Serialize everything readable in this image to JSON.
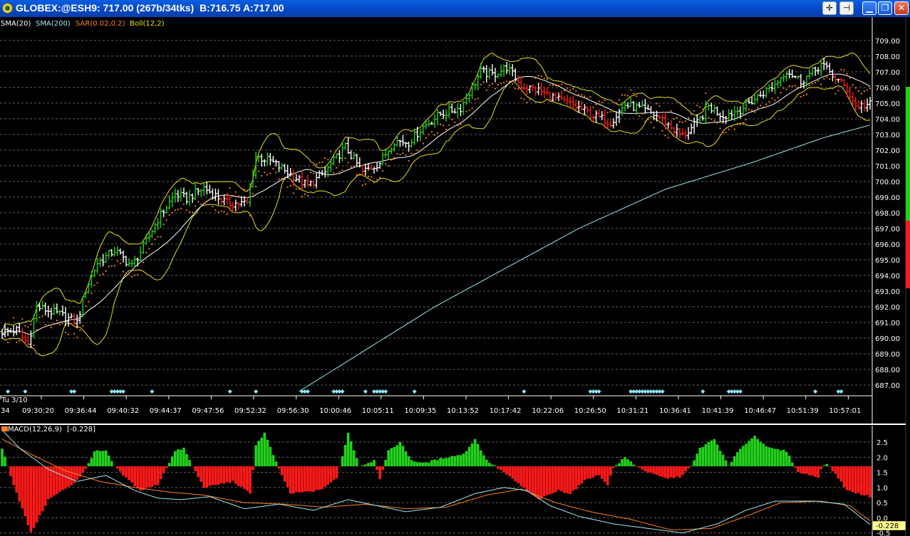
{
  "window": {
    "title": "GLOBEX:@ESH9: 717.00 (267b/34tks)  B:716.75 A:717.00",
    "buttons": [
      "crosshair-button",
      "pin-button",
      "minimize-button",
      "restore-button",
      "close-button"
    ]
  },
  "colors": {
    "up": "#22d11c",
    "down": "#ff1a1a",
    "neutral": "#ffffff",
    "sma20": "#ffffff",
    "sma200": "#9de8f0",
    "sar": "#ff8020",
    "boll": "#e8e020",
    "grid": "#606060",
    "markers": "#8fe8ff"
  },
  "chart_data": [
    {
      "type": "line",
      "title": "",
      "indicators": [
        {
          "name": "SMA(20)",
          "color": "#ffffff"
        },
        {
          "name": "SMA(200)",
          "color": "#9de8f0"
        },
        {
          "name": "SAR(0.02,0.2)",
          "color": "#ff8020"
        },
        {
          "name": "Boll(12,2)",
          "color": "#e8e020"
        }
      ],
      "ylim": [
        686.5,
        709.4
      ],
      "y_ticks": [
        "709.00",
        "708.00",
        "707.00",
        "706.00",
        "705.00",
        "704.00",
        "703.00",
        "702.00",
        "701.00",
        "700.00",
        "699.00",
        "698.00",
        "697.00",
        "696.00",
        "695.00",
        "694.00",
        "693.00",
        "692.00",
        "691.00",
        "690.00",
        "689.00",
        "688.00",
        "687.00"
      ],
      "date_label": "Tu 3/10",
      "x_ticks": [
        "34",
        "09:30:20",
        "09:36:44",
        "09:40:32",
        "09:44:37",
        "09:47:56",
        "09:52:32",
        "09:56:30",
        "10:00:46",
        "10:05:11",
        "10:09:35",
        "10:13:52",
        "10:17:42",
        "10:22:06",
        "10:26:50",
        "10:31:21",
        "10:36:41",
        "10:41:39",
        "10:46:47",
        "10:51:39",
        "10:57:01"
      ],
      "price_anchors": [
        [
          0,
          690.4
        ],
        [
          5,
          690.5
        ],
        [
          9,
          689.6
        ],
        [
          12,
          692.0
        ],
        [
          20,
          691.5
        ],
        [
          26,
          691.0
        ],
        [
          29,
          693.1
        ],
        [
          33,
          694.8
        ],
        [
          39,
          695.6
        ],
        [
          45,
          694.6
        ],
        [
          49,
          695.8
        ],
        [
          54,
          697.6
        ],
        [
          60,
          699.2
        ],
        [
          64,
          698.9
        ],
        [
          70,
          699.6
        ],
        [
          78,
          698.6
        ],
        [
          85,
          698.6
        ],
        [
          88,
          701.6
        ],
        [
          93,
          701.3
        ],
        [
          98,
          700.7
        ],
        [
          106,
          699.7
        ],
        [
          112,
          700.6
        ],
        [
          119,
          702.2
        ],
        [
          125,
          700.6
        ],
        [
          131,
          701.2
        ],
        [
          136,
          702.6
        ],
        [
          141,
          702.5
        ],
        [
          146,
          703.5
        ],
        [
          152,
          704.3
        ],
        [
          159,
          704.7
        ],
        [
          166,
          707.0
        ],
        [
          170,
          706.8
        ],
        [
          175,
          707.3
        ],
        [
          180,
          706.1
        ],
        [
          186,
          705.8
        ],
        [
          193,
          705.2
        ],
        [
          200,
          704.7
        ],
        [
          205,
          704.2
        ],
        [
          211,
          703.8
        ],
        [
          216,
          704.9
        ],
        [
          222,
          704.6
        ],
        [
          228,
          704.1
        ],
        [
          233,
          703.3
        ],
        [
          236,
          702.9
        ],
        [
          241,
          703.7
        ],
        [
          245,
          704.8
        ],
        [
          250,
          704.2
        ],
        [
          256,
          704.6
        ],
        [
          262,
          705.4
        ],
        [
          268,
          706.2
        ],
        [
          272,
          707.1
        ],
        [
          277,
          706.4
        ],
        [
          282,
          707.1
        ],
        [
          284,
          707.5
        ],
        [
          289,
          706.6
        ],
        [
          293,
          705.9
        ],
        [
          296,
          704.8
        ],
        [
          301,
          704.9
        ]
      ],
      "sma200_anchors": [
        [
          103,
          686.6
        ],
        [
          150,
          692.0
        ],
        [
          200,
          697.0
        ],
        [
          230,
          699.5
        ],
        [
          260,
          701.2
        ],
        [
          285,
          702.8
        ],
        [
          301,
          703.6
        ]
      ]
    },
    {
      "type": "bar",
      "title": "MACD(12,26,9)",
      "value_label": "-0.228",
      "ylim": [
        -0.6,
        2.9
      ],
      "y_ticks": [
        "2.5",
        "2.0",
        "1.5",
        "1.0",
        "0.5",
        "0.0",
        "-0.5"
      ],
      "baseline": 1.7,
      "histogram_anchors": [
        [
          0,
          2.3
        ],
        [
          4,
          1.1
        ],
        [
          10,
          -0.5
        ],
        [
          16,
          0.6
        ],
        [
          25,
          1.15
        ],
        [
          29,
          1.6
        ],
        [
          32,
          2.2
        ],
        [
          36,
          2.2
        ],
        [
          39,
          1.7
        ],
        [
          42,
          1.4
        ],
        [
          48,
          0.9
        ],
        [
          54,
          1.1
        ],
        [
          60,
          2.2
        ],
        [
          63,
          2.3
        ],
        [
          66,
          1.7
        ],
        [
          70,
          1.0
        ],
        [
          80,
          1.2
        ],
        [
          86,
          0.8
        ],
        [
          88,
          2.4
        ],
        [
          91,
          2.8
        ],
        [
          96,
          1.6
        ],
        [
          100,
          0.8
        ],
        [
          110,
          0.9
        ],
        [
          116,
          1.3
        ],
        [
          120,
          2.8
        ],
        [
          124,
          1.7
        ],
        [
          129,
          1.9
        ],
        [
          131,
          1.3
        ],
        [
          134,
          2.2
        ],
        [
          138,
          2.5
        ],
        [
          142,
          1.9
        ],
        [
          146,
          1.8
        ],
        [
          154,
          2.0
        ],
        [
          160,
          2.1
        ],
        [
          164,
          2.6
        ],
        [
          168,
          1.9
        ],
        [
          174,
          1.5
        ],
        [
          178,
          1.2
        ],
        [
          186,
          0.6
        ],
        [
          193,
          0.9
        ],
        [
          197,
          0.8
        ],
        [
          203,
          1.3
        ],
        [
          207,
          1.4
        ],
        [
          210,
          1.1
        ],
        [
          212,
          1.65
        ],
        [
          216,
          2.0
        ],
        [
          220,
          1.7
        ],
        [
          224,
          1.5
        ],
        [
          230,
          1.3
        ],
        [
          235,
          1.35
        ],
        [
          239,
          1.7
        ],
        [
          242,
          2.3
        ],
        [
          247,
          2.6
        ],
        [
          252,
          1.7
        ],
        [
          256,
          2.3
        ],
        [
          261,
          2.7
        ],
        [
          266,
          2.3
        ],
        [
          272,
          2.2
        ],
        [
          276,
          1.5
        ],
        [
          283,
          1.35
        ],
        [
          284,
          1.6
        ],
        [
          286,
          1.8
        ],
        [
          287,
          1.65
        ],
        [
          289,
          1.45
        ],
        [
          293,
          0.9
        ],
        [
          301,
          0.7
        ]
      ],
      "macd_anchors": [
        [
          0,
          2.9
        ],
        [
          6,
          2.3
        ],
        [
          16,
          1.6
        ],
        [
          26,
          1.2
        ],
        [
          36,
          1.4
        ],
        [
          46,
          0.9
        ],
        [
          54,
          0.65
        ],
        [
          62,
          0.6
        ],
        [
          72,
          0.7
        ],
        [
          84,
          0.3
        ],
        [
          96,
          0.45
        ],
        [
          108,
          0.25
        ],
        [
          120,
          0.6
        ],
        [
          130,
          0.4
        ],
        [
          140,
          0.2
        ],
        [
          152,
          0.35
        ],
        [
          164,
          0.8
        ],
        [
          174,
          1.0
        ],
        [
          182,
          0.9
        ],
        [
          190,
          0.4
        ],
        [
          200,
          0.05
        ],
        [
          212,
          -0.2
        ],
        [
          224,
          -0.35
        ],
        [
          236,
          -0.5
        ],
        [
          248,
          -0.2
        ],
        [
          258,
          0.25
        ],
        [
          268,
          0.55
        ],
        [
          282,
          0.55
        ],
        [
          292,
          0.45
        ],
        [
          301,
          -0.22
        ]
      ],
      "signal_anchors": [
        [
          0,
          2.6
        ],
        [
          10,
          2.1
        ],
        [
          22,
          1.55
        ],
        [
          34,
          1.2
        ],
        [
          46,
          1.0
        ],
        [
          58,
          0.85
        ],
        [
          70,
          0.75
        ],
        [
          84,
          0.5
        ],
        [
          98,
          0.45
        ],
        [
          112,
          0.35
        ],
        [
          126,
          0.45
        ],
        [
          140,
          0.3
        ],
        [
          154,
          0.35
        ],
        [
          168,
          0.75
        ],
        [
          180,
          0.95
        ],
        [
          192,
          0.5
        ],
        [
          204,
          0.2
        ],
        [
          218,
          -0.05
        ],
        [
          232,
          -0.4
        ],
        [
          246,
          -0.35
        ],
        [
          258,
          0.05
        ],
        [
          270,
          0.5
        ],
        [
          284,
          0.55
        ],
        [
          294,
          0.4
        ],
        [
          301,
          -0.1
        ]
      ]
    }
  ]
}
